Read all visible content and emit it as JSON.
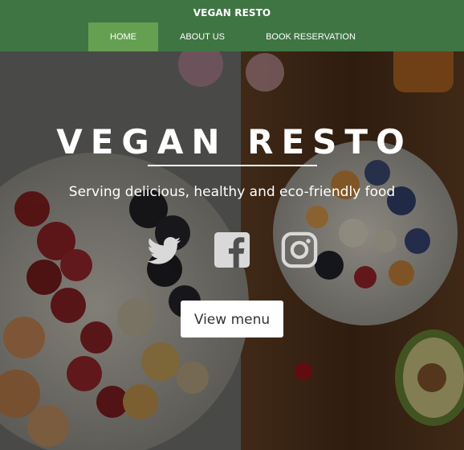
{
  "header": {
    "brand": "VEGAN RESTO",
    "nav": [
      {
        "label": "HOME",
        "active": true
      },
      {
        "label": "ABOUT US",
        "active": false
      },
      {
        "label": "BOOK RESERVATION",
        "active": false
      }
    ]
  },
  "hero": {
    "title": "VEGAN RESTO",
    "subtitle": "Serving delicious, healthy and eco-friendly food",
    "social": [
      {
        "icon": "twitter-icon"
      },
      {
        "icon": "facebook-icon"
      },
      {
        "icon": "instagram-icon"
      }
    ],
    "cta_label": "View menu"
  },
  "colors": {
    "navbar": "#3f7543",
    "nav_active": "#65a052",
    "text": "#ffffff",
    "icon": "#d9d9d9"
  }
}
